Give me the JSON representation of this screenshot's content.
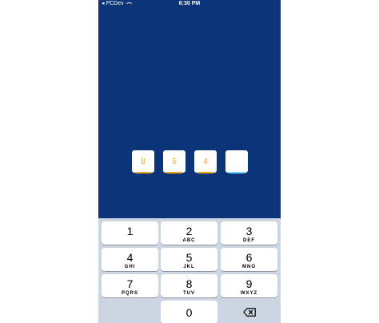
{
  "status_bar": {
    "carrier": "◂ PCDev",
    "time": "6:30 PM"
  },
  "pin": {
    "digits": [
      "8",
      "5",
      "4",
      ""
    ],
    "active_index": 3
  },
  "keypad": {
    "keys": [
      {
        "digit": "1",
        "letters": ""
      },
      {
        "digit": "2",
        "letters": "ABC"
      },
      {
        "digit": "3",
        "letters": "DEF"
      },
      {
        "digit": "4",
        "letters": "GHI"
      },
      {
        "digit": "5",
        "letters": "JKL"
      },
      {
        "digit": "6",
        "letters": "MNO"
      },
      {
        "digit": "7",
        "letters": "PQRS"
      },
      {
        "digit": "8",
        "letters": "TUV"
      },
      {
        "digit": "9",
        "letters": "WXYZ"
      },
      {
        "digit": "0",
        "letters": ""
      }
    ],
    "delete_icon": "backspace-icon"
  },
  "colors": {
    "background": "#0b3578",
    "accent": "#f2a51a",
    "active": "#6fd1ff",
    "keyboard": "#ccd5e1"
  }
}
